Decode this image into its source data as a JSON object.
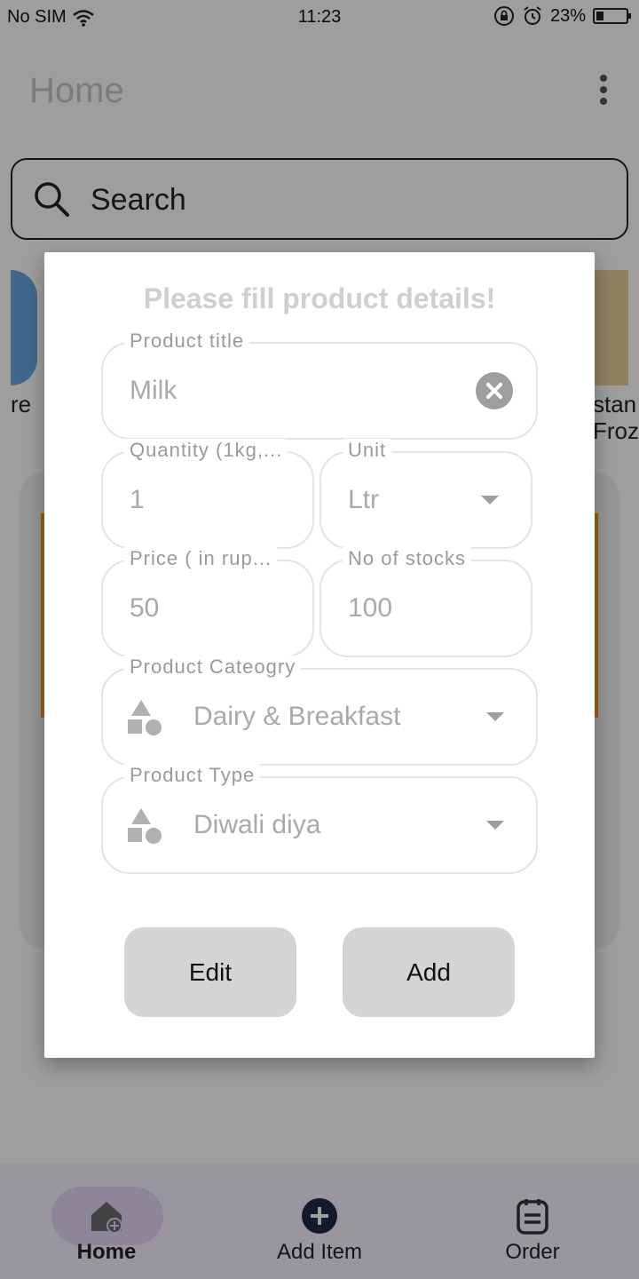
{
  "status_bar": {
    "carrier": "No SIM",
    "time": "11:23",
    "battery": "23%"
  },
  "app_bar": {
    "title": "Home"
  },
  "search": {
    "placeholder": "Search"
  },
  "background": {
    "left_label": "re",
    "right_label": "stan Froz"
  },
  "dialog": {
    "title": "Please fill product details!",
    "fields": {
      "product_title": {
        "label": "Product title",
        "value": "Milk"
      },
      "quantity": {
        "label": "Quantity (1kg,...",
        "value": "1"
      },
      "unit": {
        "label": "Unit",
        "value": "Ltr"
      },
      "price": {
        "label": "Price ( in rup...",
        "value": "50"
      },
      "stocks": {
        "label": "No of stocks",
        "value": "100"
      },
      "category": {
        "label": "Product Cateogry",
        "value": "Dairy & Breakfast"
      },
      "type": {
        "label": "Product Type",
        "value": "Diwali diya"
      }
    },
    "buttons": {
      "edit": "Edit",
      "add": "Add"
    }
  },
  "bottom_nav": {
    "home": "Home",
    "add_item": "Add Item",
    "order": "Order"
  },
  "colors": {
    "accent": "#e2d8f5",
    "button_bg": "#d5d4d5"
  }
}
